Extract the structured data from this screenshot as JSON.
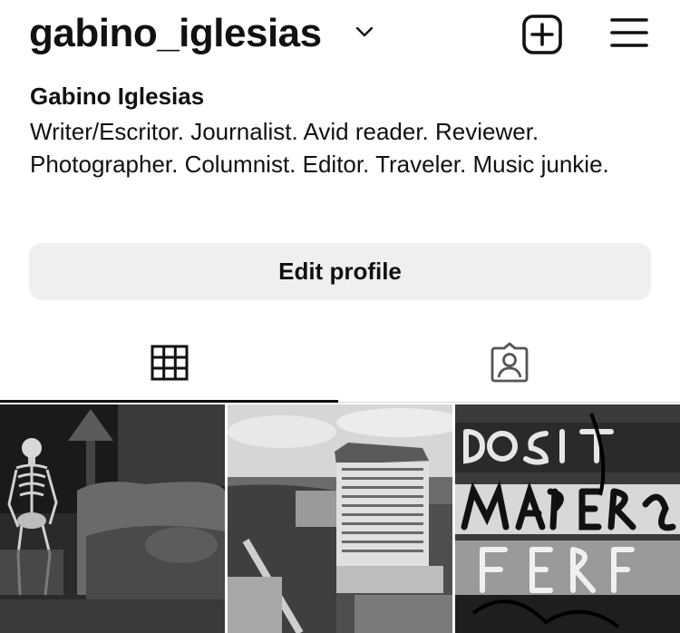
{
  "header": {
    "username": "gabino_iglesias",
    "icons": {
      "switch_account": "chevron-down-icon",
      "create": "plus-square-icon",
      "menu": "hamburger-menu-icon"
    }
  },
  "profile": {
    "display_name": "Gabino Iglesias",
    "bio": "Writer/Escritor. Journalist. Avid reader. Reviewer. Photographer. Columnist. Editor. Traveler. Music junkie."
  },
  "actions": {
    "edit_profile_label": "Edit profile"
  },
  "tabs": [
    {
      "icon": "grid-icon",
      "active": true
    },
    {
      "icon": "tagged-person-icon",
      "active": false
    }
  ],
  "posts": [
    {
      "subject": "skeleton seated in a vintage parlor"
    },
    {
      "subject": "aerial view of city office building"
    },
    {
      "subject": "graffiti covered wall"
    }
  ],
  "colors": {
    "text": "#111111",
    "button_bg": "#efefef",
    "background": "#ffffff",
    "divider": "#d8d8d8"
  }
}
